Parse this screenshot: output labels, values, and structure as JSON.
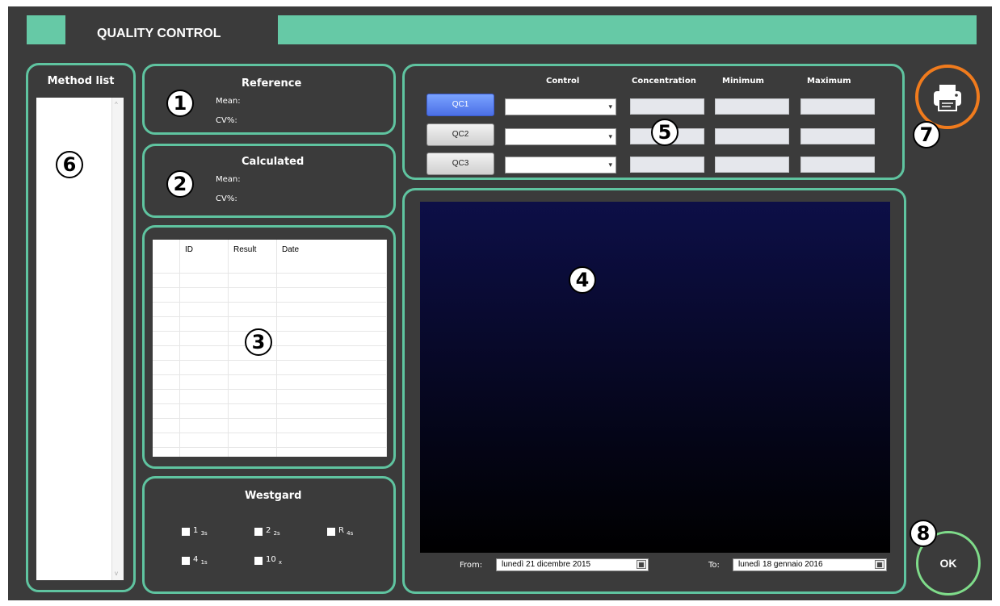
{
  "header": {
    "title": "QUALITY CONTROL"
  },
  "method_list": {
    "title": "Method list"
  },
  "reference": {
    "title": "Reference",
    "mean_label": "Mean:",
    "cv_label": "CV%:"
  },
  "calculated": {
    "title": "Calculated",
    "mean_label": "Mean:",
    "cv_label": "CV%:"
  },
  "results_table": {
    "columns": [
      "ID",
      "Result",
      "Date"
    ]
  },
  "westgard": {
    "title": "Westgard",
    "rules": [
      {
        "main": "1",
        "sub": "3s"
      },
      {
        "main": "2",
        "sub": "2s"
      },
      {
        "main": "R",
        "sub": "4s"
      },
      {
        "main": "4",
        "sub": "1s"
      },
      {
        "main": "10",
        "sub": "x"
      }
    ]
  },
  "controls": {
    "columns": [
      "Control",
      "Concentration",
      "Minimum",
      "Maximum"
    ],
    "qc_buttons": [
      "QC1",
      "QC2",
      "QC3"
    ],
    "active": "QC1"
  },
  "date_range": {
    "from_label": "From:",
    "from_value": "lunedì   21 dicembre 2015",
    "to_label": "To:",
    "to_value": "lunedì   18 gennaio  2016"
  },
  "actions": {
    "ok_label": "OK"
  },
  "callouts": [
    "1",
    "2",
    "3",
    "4",
    "5",
    "6",
    "7",
    "8"
  ],
  "icons": {
    "print": "printer-icon"
  },
  "colors": {
    "accent": "#5fc4a0",
    "print_ring": "#f07b1d",
    "ok_ring": "#7fdc8a",
    "chart_top": "#0d0f47",
    "chart_bottom": "#000000"
  }
}
